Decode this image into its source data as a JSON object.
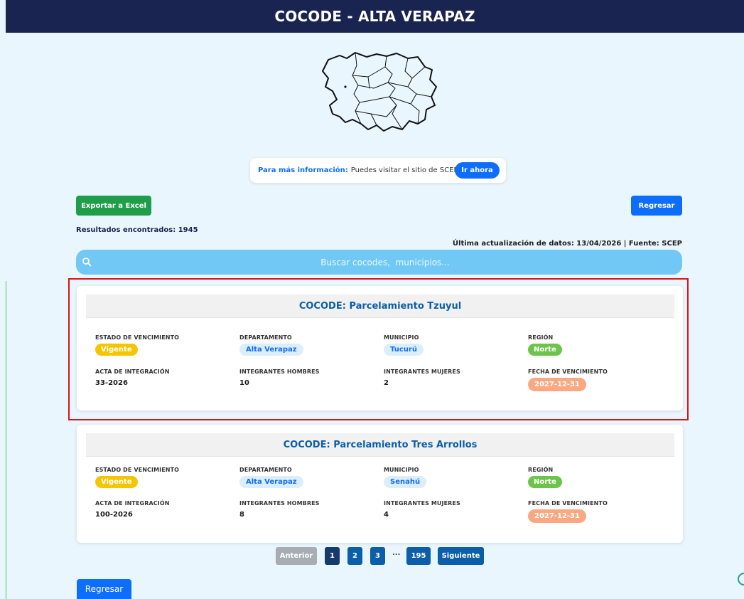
{
  "header": {
    "title": "COCODE - ALTA VERAPAZ"
  },
  "info": {
    "lead": "Para más información:",
    "text": "Puedes visitar el sitio de SCEP:",
    "button": "Ir ahora"
  },
  "actions": {
    "export_excel": "Exportar a Excel",
    "back_top": "Regresar"
  },
  "results_text": "Resultados encontrados: 1945",
  "updated_text": "Última actualización de datos: 13/04/2026 | Fuente: SCEP",
  "search": {
    "placeholder": "Buscar cocodes,  municipios..."
  },
  "labels": {
    "estado": "ESTADO DE VENCIMIENTO",
    "departamento": "DEPARTAMENTO",
    "municipio": "MUNICIPIO",
    "region": "REGIÓN",
    "acta": "ACTA DE INTEGRACIÓN",
    "hombres": "INTEGRANTES HOMBRES",
    "mujeres": "INTEGRANTES MUJERES",
    "fecha": "FECHA DE VENCIMIENTO"
  },
  "cards": [
    {
      "title": "COCODE: Parcelamiento Tzuyul",
      "estado": "Vigente",
      "departamento": "Alta Verapaz",
      "municipio": "Tucurú",
      "region": "Norte",
      "acta": "33-2026",
      "hombres": "10",
      "mujeres": "2",
      "fecha": "2027-12-31"
    },
    {
      "title": "COCODE: Parcelamiento Tres Arrollos",
      "estado": "Vigente",
      "departamento": "Alta Verapaz",
      "municipio": "Senahú",
      "region": "Norte",
      "acta": "100-2026",
      "hombres": "8",
      "mujeres": "4",
      "fecha": "2027-12-31"
    }
  ],
  "pagination": {
    "prev": "Anterior",
    "pages": [
      "1",
      "2",
      "3"
    ],
    "ellipsis": "...",
    "last": "195",
    "next": "Siguiente"
  },
  "back_bottom": "Regresar",
  "icons": [
    "search-icon",
    "map-icon",
    "circle-check-icon"
  ],
  "colors": {
    "header": "#1a2450",
    "primary": "#0d6efd",
    "excel": "#1f9d4a",
    "search": "#71c8f5",
    "vigente": "#f7c500",
    "region": "#6cc44a",
    "fecha": "#f9a882",
    "highlight": "#e0121a"
  }
}
